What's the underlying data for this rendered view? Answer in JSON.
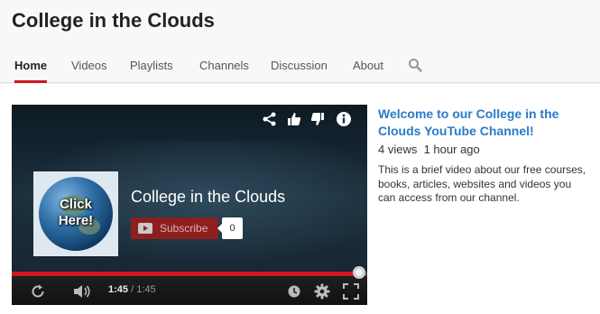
{
  "channel": {
    "title": "College in the Clouds"
  },
  "tabs": [
    {
      "label": "Home",
      "active": true
    },
    {
      "label": "Videos",
      "active": false
    },
    {
      "label": "Playlists",
      "active": false
    },
    {
      "label": "Channels",
      "active": false
    },
    {
      "label": "Discussion",
      "active": false
    },
    {
      "label": "About",
      "active": false
    }
  ],
  "player": {
    "title": "College in the Clouds",
    "thumbnail_text_line1": "Click",
    "thumbnail_text_line2": "Here!",
    "subscribe_label": "Subscribe",
    "subscriber_count": "0",
    "current_time": "1:45",
    "duration": "/ 1:45",
    "progress_fraction": 1.0,
    "top_icons": [
      "share-icon",
      "like-icon",
      "dislike-icon",
      "info-icon"
    ],
    "control_icons": [
      "replay-icon",
      "volume-icon",
      "watch-later-icon",
      "settings-icon",
      "fullscreen-icon"
    ]
  },
  "featured": {
    "title": "Welcome to our College in the Clouds YouTube Channel!",
    "views": "4 views",
    "age": "1 hour ago",
    "description": "This is a brief video about our free courses, books, articles, websites and videos you can access from our channel."
  },
  "colors": {
    "accent": "#cc181e",
    "link": "#2a7bc8"
  }
}
